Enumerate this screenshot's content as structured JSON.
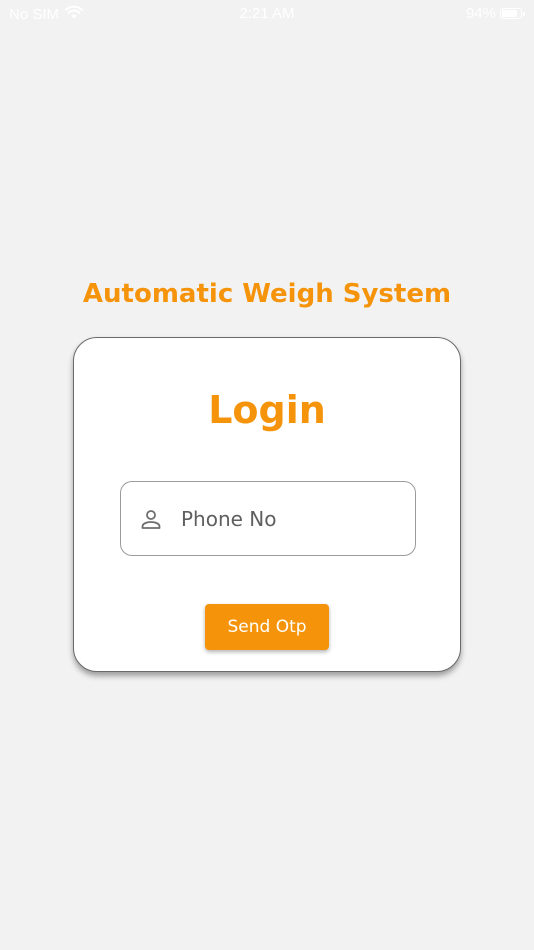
{
  "status_bar": {
    "carrier": "No SIM",
    "time": "2:21 AM",
    "battery_percent_label": "94%",
    "battery_level": 0.94
  },
  "app": {
    "title": "Automatic Weigh System"
  },
  "login_card": {
    "title": "Login",
    "phone_field": {
      "placeholder": "Phone No",
      "value": ""
    },
    "send_button_label": "Send Otp"
  },
  "colors": {
    "accent": "#f5940a",
    "background": "#f2f2f2",
    "card": "#ffffff"
  },
  "icons": {
    "phone_field_icon": "person-icon",
    "wifi": "wifi-icon",
    "battery": "battery-icon"
  }
}
